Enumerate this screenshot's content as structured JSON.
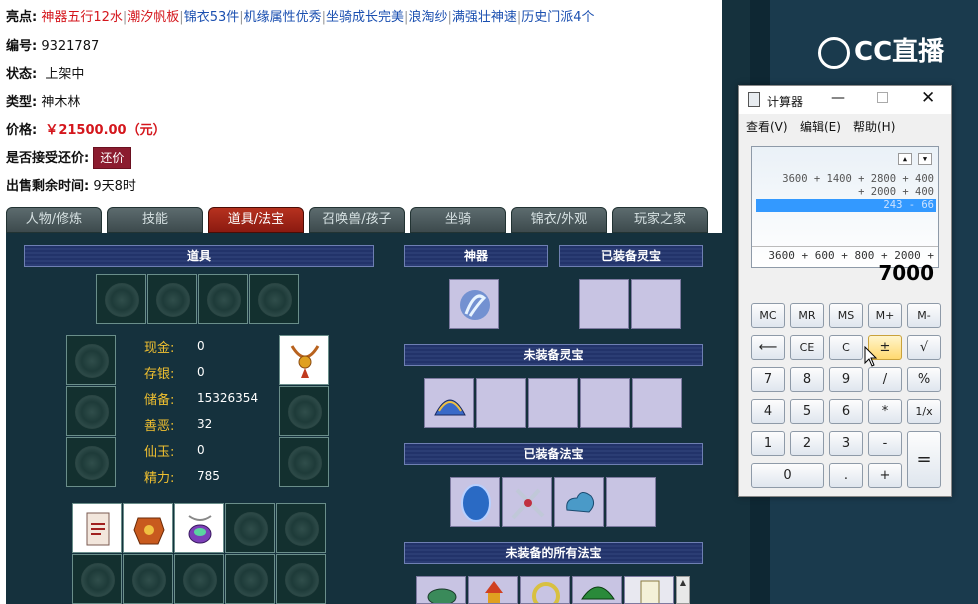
{
  "listing": {
    "highlights_label": "亮点:",
    "highlights": [
      "神器五行12水",
      "潮汐帆板",
      "锦衣53件",
      "机缘属性优秀",
      "坐骑成长完美",
      "浪淘纱",
      "满强壮神速",
      "历史门派4个"
    ],
    "id_label": "编号:",
    "id_value": "9321787",
    "status_label": "状态:",
    "status_value": "上架中",
    "type_label": "类型:",
    "type_value": "神木林",
    "price_label": "价格:",
    "price_value": "￥21500.00（元）",
    "haggle_label": "是否接受还价:",
    "haggle_button": "还价",
    "remaining_label": "出售剩余时间:",
    "remaining_value": "9天8时"
  },
  "tabs": [
    {
      "label": "人物/修炼",
      "active": false
    },
    {
      "label": "技能",
      "active": false
    },
    {
      "label": "道具/法宝",
      "active": true
    },
    {
      "label": "召唤兽/孩子",
      "active": false
    },
    {
      "label": "坐骑",
      "active": false
    },
    {
      "label": "锦衣/外观",
      "active": false
    },
    {
      "label": "玩家之家",
      "active": false
    }
  ],
  "panel": {
    "props_header": "道具",
    "artifact_header": "神器",
    "equipped_lingbao_header": "已装备灵宝",
    "unequipped_lingbao_header": "未装备灵宝",
    "equipped_fabao_header": "已装备法宝",
    "all_unequipped_fabao_header": "未装备的所有法宝",
    "stats": [
      {
        "label": "现金:",
        "value": "0"
      },
      {
        "label": "存银:",
        "value": "0"
      },
      {
        "label": "储备:",
        "value": "15326354"
      },
      {
        "label": "善恶:",
        "value": "32"
      },
      {
        "label": "仙玉:",
        "value": "0"
      },
      {
        "label": "精力:",
        "value": "785"
      }
    ]
  },
  "sidebar": {
    "logo_text": "CC直播"
  },
  "calculator": {
    "title": "计算器",
    "menu": [
      "查看(V)",
      "编辑(E)",
      "帮助(H)"
    ],
    "history_lines": [
      "3600 + 1400 + 2800 + 400",
      "+ 2000 + 400"
    ],
    "history_selected": "243 - 66",
    "expression": "3600 + 600 + 800 + 2000 +",
    "result": "7000",
    "buttons": {
      "mc": "MC",
      "mr": "MR",
      "ms": "MS",
      "mplus": "M+",
      "mminus": "M-",
      "back": "⟵",
      "ce": "CE",
      "c": "C",
      "pm": "±",
      "sqrt": "√",
      "n7": "7",
      "n8": "8",
      "n9": "9",
      "div": "/",
      "pct": "%",
      "n4": "4",
      "n5": "5",
      "n6": "6",
      "mul": "*",
      "inv": "1/x",
      "n1": "1",
      "n2": "2",
      "n3": "3",
      "sub": "-",
      "eq": "=",
      "n0": "0",
      "dot": ".",
      "add": "+"
    }
  },
  "colors": {
    "price_red": "#d4161c",
    "link_blue": "#1a4fb0",
    "panel_bg": "#15313d",
    "tab_active": "#b6321f",
    "header_blue": "#2b3d74"
  }
}
